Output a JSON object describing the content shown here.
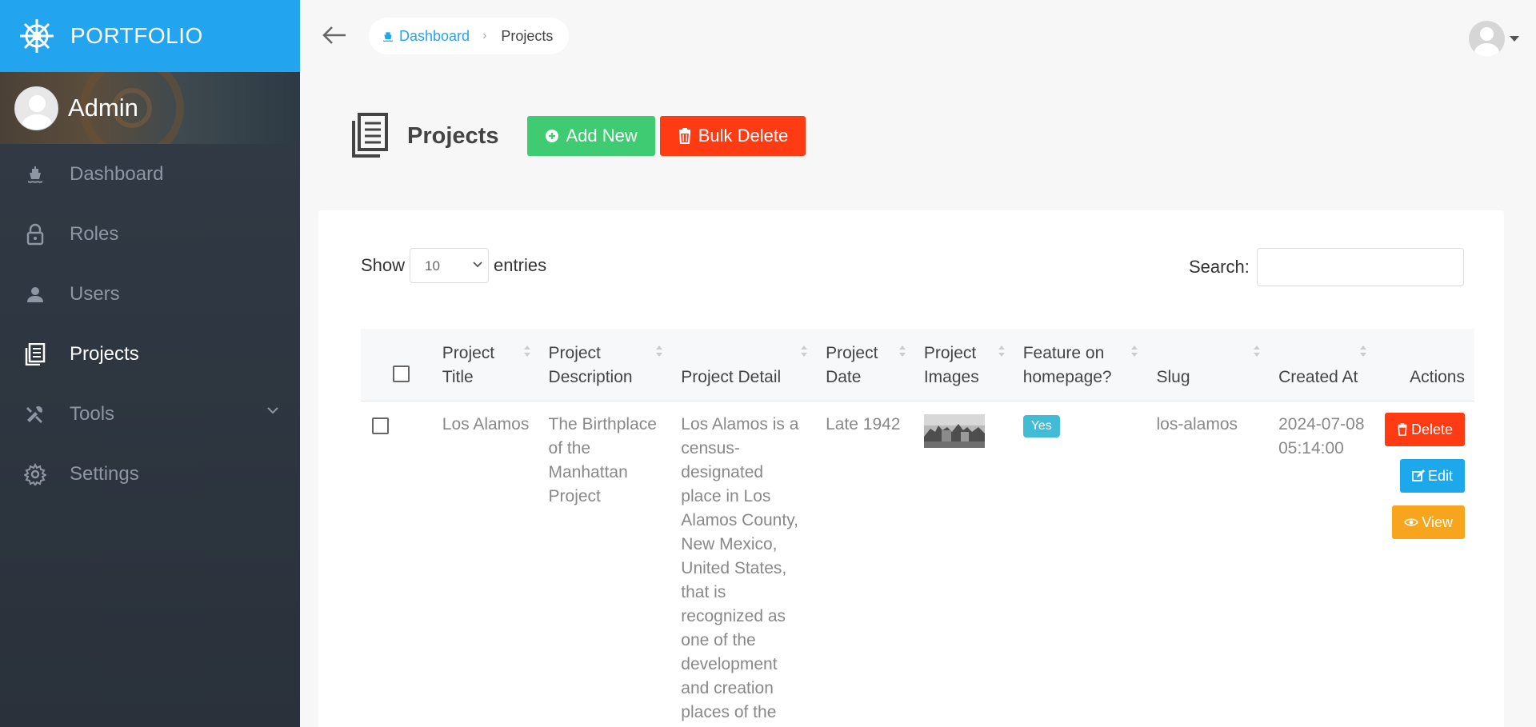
{
  "brand": {
    "name": "PORTFOLIO"
  },
  "sidebar": {
    "user": "Admin",
    "items": [
      {
        "label": "Dashboard",
        "icon": "ship-icon"
      },
      {
        "label": "Roles",
        "icon": "lock-icon"
      },
      {
        "label": "Users",
        "icon": "user-icon"
      },
      {
        "label": "Projects",
        "icon": "document-icon",
        "active": true
      },
      {
        "label": "Tools",
        "icon": "tools-icon"
      },
      {
        "label": "Settings",
        "icon": "gear-icon"
      }
    ]
  },
  "breadcrumb": {
    "home": "Dashboard",
    "current": "Projects"
  },
  "page": {
    "title": "Projects",
    "add_label": "Add New",
    "bulk_delete_label": "Bulk Delete"
  },
  "table_controls": {
    "show_label": "Show",
    "entries_label": "entries",
    "page_length": "10",
    "search_label": "Search:",
    "search_value": ""
  },
  "table": {
    "columns": [
      "Project Title",
      "Project Description",
      "Project Detail",
      "Project Date",
      "Project Images",
      "Feature on homepage?",
      "Slug",
      "Created At",
      "Actions"
    ],
    "rows": [
      {
        "title": "Los Alamos",
        "description": "The Birthplace of the Manhattan Project",
        "detail": "Los Alamos is a census-designated place in Los Alamos County, New Mexico, United States, that is recognized as one of the development and creation places of the",
        "date": "Late 1942",
        "featured": "Yes",
        "slug": "los-alamos",
        "created_at": "2024-07-08 05:14:00",
        "actions": {
          "delete": "Delete",
          "edit": "Edit",
          "view": "View"
        }
      }
    ]
  },
  "colors": {
    "brand": "#23a4ee",
    "sidebar": "#2d3540",
    "add": "#3ecb71",
    "danger": "#ff3b14",
    "edit": "#1ea8ec",
    "view": "#f7a51c",
    "badge": "#42bcd6"
  }
}
